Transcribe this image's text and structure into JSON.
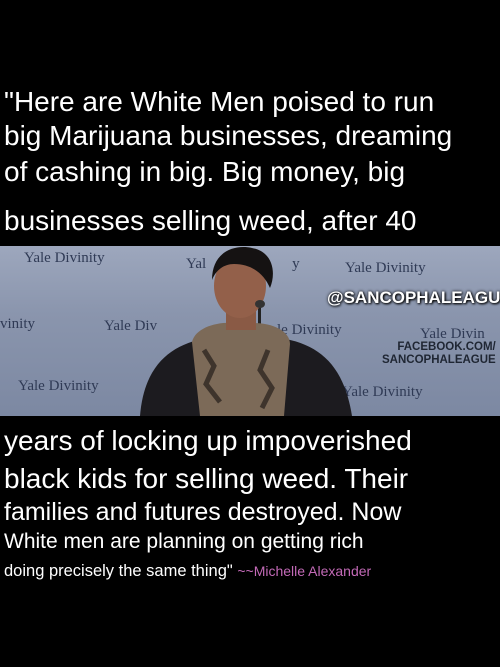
{
  "quote": {
    "line1": "\"Here are White Men poised to run",
    "line2": "big Marijuana businesses, dreaming",
    "line3": "of cashing in big. Big money, big",
    "line4": "businesses selling weed, after 40",
    "line5": "years of locking up impoverished",
    "line6": "black kids for selling weed. Their",
    "line7": "families and futures destroyed. Now",
    "line8": "White men are planning on getting rich",
    "line9": "doing precisely the same thing\"",
    "attribution": "~~Michelle Alexander"
  },
  "photo": {
    "banner": {
      "t1": "Yale Divinity",
      "t2": "Yal",
      "t2b": "y",
      "t3": "Yale Divinity",
      "t4": "vinity",
      "t5": "Yale Div",
      "t6": "le Divinity",
      "t7": "Yale Divin",
      "t8": "Yale Divinity",
      "t9": "Yale Divinity"
    },
    "watermark_handle": "@SANCOPHALEAGUE",
    "watermark_fb_1": "FACEBOOK.COM/",
    "watermark_fb_2": "SANCOPHALEAGUE"
  },
  "colors": {
    "background": "#000000",
    "text": "#ffffff",
    "attribution": "#c36ab7"
  }
}
